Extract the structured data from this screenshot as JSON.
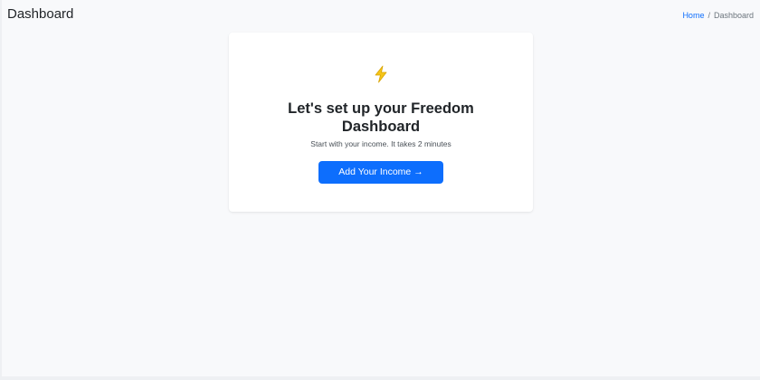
{
  "header": {
    "title": "Dashboard"
  },
  "breadcrumb": {
    "home_label": "Home",
    "separator": "/",
    "current_label": "Dashboard"
  },
  "onboarding_card": {
    "icon": "lightning-bolt-icon",
    "heading": "Let's set up your Freedom Dashboard",
    "subtitle": "Start with your income. It takes 2 minutes",
    "button_label": "Add Your Income →"
  },
  "colors": {
    "accent": "#0d6efd",
    "icon": "#f5c518",
    "background": "#f8f9fb",
    "card": "#ffffff"
  }
}
